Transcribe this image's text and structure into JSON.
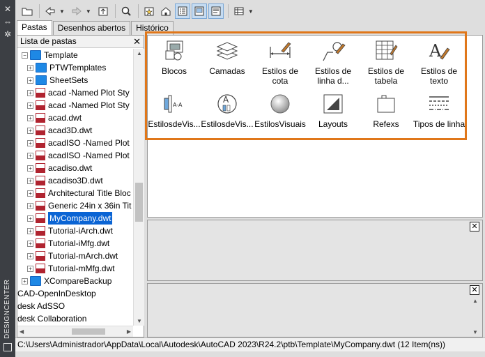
{
  "strip": {
    "title": "DESIGNCENTER"
  },
  "tabs": [
    {
      "label": "Pastas",
      "active": true
    },
    {
      "label": "Desenhos abertos",
      "active": false
    },
    {
      "label": "Histórico",
      "active": false
    }
  ],
  "left_pane": {
    "header": "Lista de pastas",
    "tree": [
      {
        "label": "Template",
        "icon": "folder-icon",
        "expanded": true
      },
      {
        "label": "PTWTemplates",
        "icon": "folder-icon"
      },
      {
        "label": "SheetSets",
        "icon": "folder-icon"
      },
      {
        "label": "acad -Named Plot Sty",
        "icon": "dwt-file-icon"
      },
      {
        "label": "acad -Named Plot Sty",
        "icon": "dwt-file-icon"
      },
      {
        "label": "acad.dwt",
        "icon": "dwt-file-icon"
      },
      {
        "label": "acad3D.dwt",
        "icon": "dwt-file-icon"
      },
      {
        "label": "acadISO -Named Plot",
        "icon": "dwt-file-icon"
      },
      {
        "label": "acadISO -Named Plot",
        "icon": "dwt-file-icon"
      },
      {
        "label": "acadiso.dwt",
        "icon": "dwt-file-icon"
      },
      {
        "label": "acadiso3D.dwt",
        "icon": "dwt-file-icon"
      },
      {
        "label": "Architectural Title Bloc",
        "icon": "dwt-file-icon"
      },
      {
        "label": "Generic 24in x 36in Tit",
        "icon": "dwt-file-icon"
      },
      {
        "label": "MyCompany.dwt",
        "icon": "dwt-file-icon",
        "selected": true
      },
      {
        "label": "Tutorial-iArch.dwt",
        "icon": "dwt-file-icon"
      },
      {
        "label": "Tutorial-iMfg.dwt",
        "icon": "dwt-file-icon"
      },
      {
        "label": "Tutorial-mArch.dwt",
        "icon": "dwt-file-icon"
      },
      {
        "label": "Tutorial-mMfg.dwt",
        "icon": "dwt-file-icon"
      },
      {
        "label": "XCompareBackup",
        "icon": "folder-icon"
      },
      {
        "label": "CAD-OpenInDesktop",
        "icon": ""
      },
      {
        "label": "desk AdSSO",
        "icon": ""
      },
      {
        "label": "desk Collaboration",
        "icon": ""
      }
    ]
  },
  "grid": {
    "items": [
      {
        "label": "Blocos",
        "icon": "blocks-icon"
      },
      {
        "label": "Camadas",
        "icon": "layers-icon"
      },
      {
        "label": "Estilos de cota",
        "icon": "dimension-styles-icon"
      },
      {
        "label": "Estilos de linha d...",
        "icon": "multileader-styles-icon"
      },
      {
        "label": "Estilos de tabela",
        "icon": "table-styles-icon"
      },
      {
        "label": "Estilos de texto",
        "icon": "text-styles-icon"
      },
      {
        "label": "EstilosdeVis...",
        "icon": "visual-styles-a-icon"
      },
      {
        "label": "EstilosdeVis...",
        "icon": "visual-styles-b-icon"
      },
      {
        "label": "EstilosVisuais",
        "icon": "visual-styles-sphere-icon"
      },
      {
        "label": "Layouts",
        "icon": "layouts-icon"
      },
      {
        "label": "Refexs",
        "icon": "xrefs-icon"
      },
      {
        "label": "Tipos de linha",
        "icon": "linetypes-icon"
      }
    ]
  },
  "status": {
    "path": "C:\\Users\\Administrador\\AppData\\Local\\Autodesk\\AutoCAD 2023\\R24.2\\ptb\\Template\\MyCompany.dwt (12 Item(ns))"
  },
  "colors": {
    "highlight": "#e0771a",
    "selection": "#0a64d4",
    "strip": "#3c3f44"
  }
}
